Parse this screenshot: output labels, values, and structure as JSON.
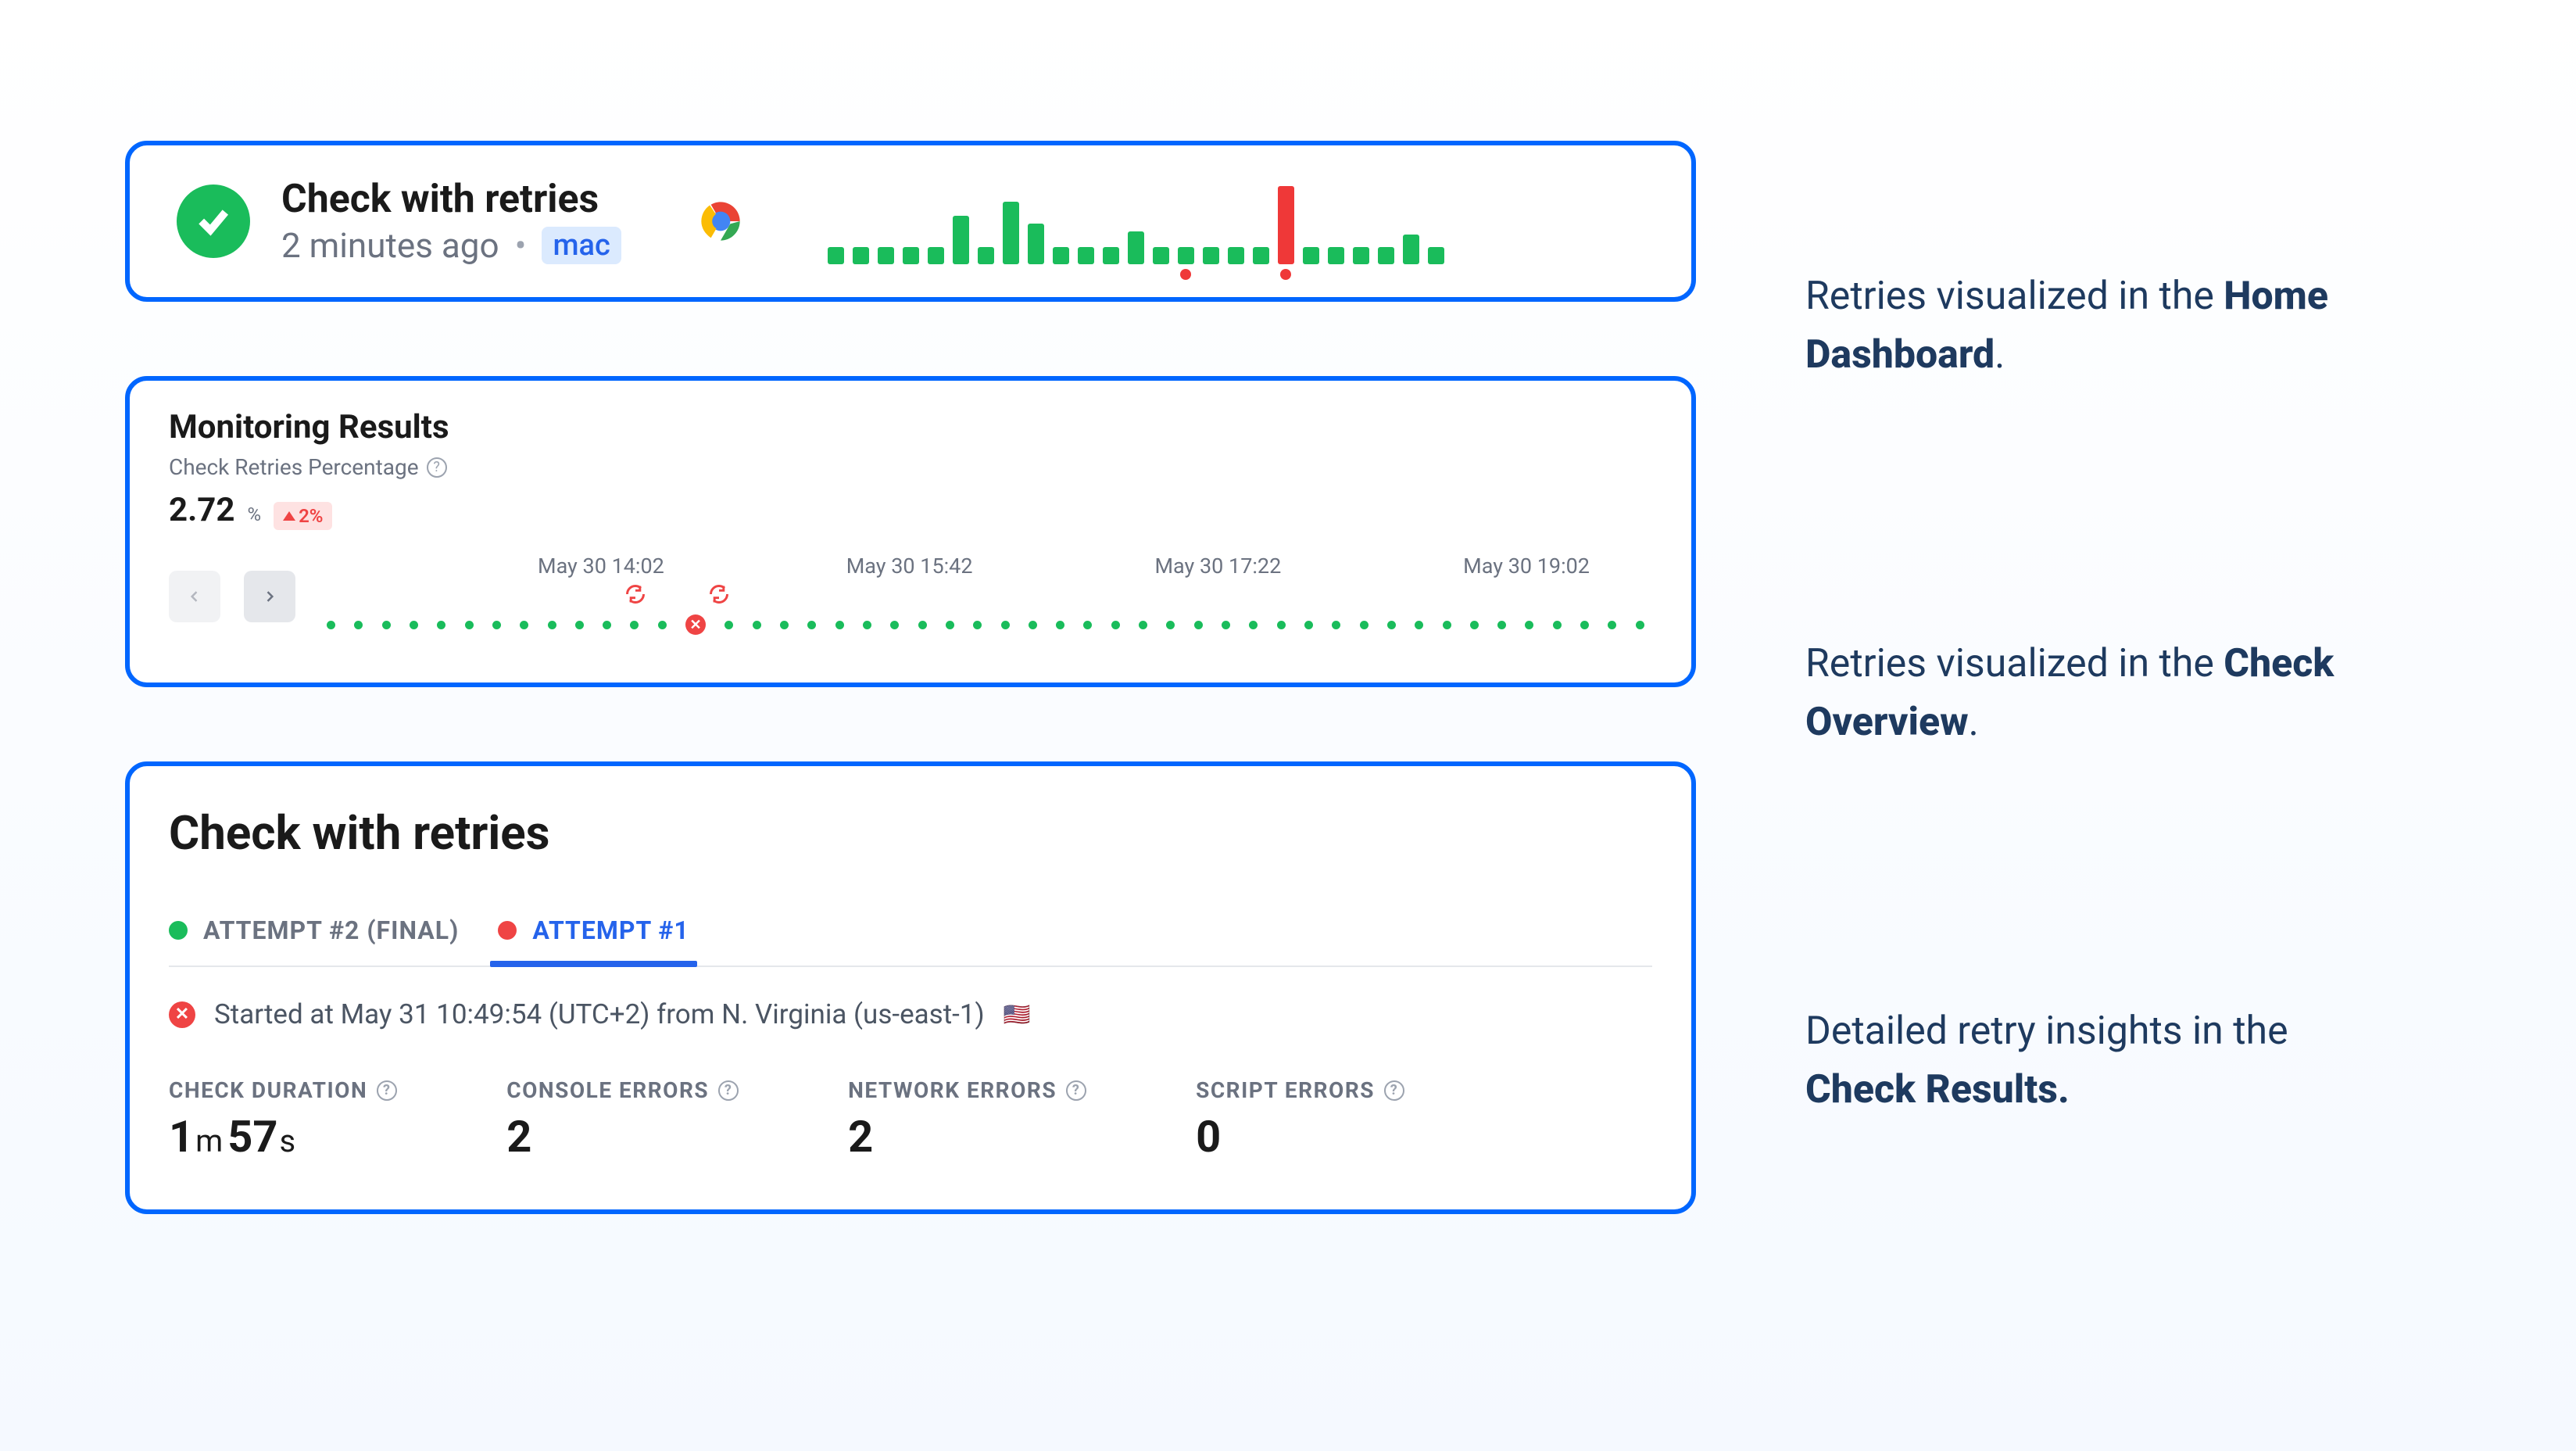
{
  "home": {
    "title": "Check with retries",
    "timeAgo": "2 minutes ago",
    "tag": "mac"
  },
  "monitor": {
    "title": "Monitoring Results",
    "subtitle": "Check Retries Percentage",
    "value": "2.72",
    "unit": "%",
    "trend": "2%",
    "timeLabels": [
      "May 30 14:02",
      "May 30 15:42",
      "May 30 17:22",
      "May 30 19:02"
    ]
  },
  "results": {
    "title": "Check with retries",
    "tabs": [
      {
        "label": "ATTEMPT #2 (FINAL)",
        "status": "green"
      },
      {
        "label": "ATTEMPT #1",
        "status": "red"
      }
    ],
    "activeTab": 1,
    "startedText": "Started at May 31 10:49:54 (UTC+2) from N. Virginia (us-east-1)",
    "flag": "🇺🇸",
    "metrics": [
      {
        "label": "CHECK DURATION",
        "value": "1m 57s",
        "isDuration": true,
        "m": "1",
        "s": "57"
      },
      {
        "label": "CONSOLE ERRORS",
        "value": "2"
      },
      {
        "label": "NETWORK ERRORS",
        "value": "2"
      },
      {
        "label": "SCRIPT ERRORS",
        "value": "0"
      }
    ]
  },
  "annotations": {
    "a1_prefix": "Retries visualized in the ",
    "a1_bold": "Home Dashboard",
    "a2_prefix": "Retries visualized in the ",
    "a2_bold": "Check Overview",
    "a3_prefix": "Detailed retry insights in the ",
    "a3_bold": "Check Results."
  },
  "chart_data": {
    "sparkline": {
      "type": "bar",
      "bars": [
        {
          "h": 22,
          "c": "g"
        },
        {
          "h": 22,
          "c": "g"
        },
        {
          "h": 22,
          "c": "g"
        },
        {
          "h": 22,
          "c": "g"
        },
        {
          "h": 22,
          "c": "g"
        },
        {
          "h": 62,
          "c": "g"
        },
        {
          "h": 22,
          "c": "g"
        },
        {
          "h": 80,
          "c": "g"
        },
        {
          "h": 52,
          "c": "g"
        },
        {
          "h": 22,
          "c": "g"
        },
        {
          "h": 22,
          "c": "g"
        },
        {
          "h": 22,
          "c": "g"
        },
        {
          "h": 42,
          "c": "g"
        },
        {
          "h": 22,
          "c": "g"
        },
        {
          "h": 22,
          "c": "g",
          "retry": true
        },
        {
          "h": 22,
          "c": "g"
        },
        {
          "h": 22,
          "c": "g"
        },
        {
          "h": 22,
          "c": "g"
        },
        {
          "h": 100,
          "c": "r",
          "retry": true
        },
        {
          "h": 22,
          "c": "g"
        },
        {
          "h": 22,
          "c": "g"
        },
        {
          "h": 22,
          "c": "g"
        },
        {
          "h": 22,
          "c": "g"
        },
        {
          "h": 38,
          "c": "g"
        },
        {
          "h": 22,
          "c": "g"
        }
      ]
    },
    "timeline": {
      "type": "scatter",
      "count": 48,
      "failIndex": 13,
      "retryPositions": [
        11,
        14
      ]
    }
  }
}
